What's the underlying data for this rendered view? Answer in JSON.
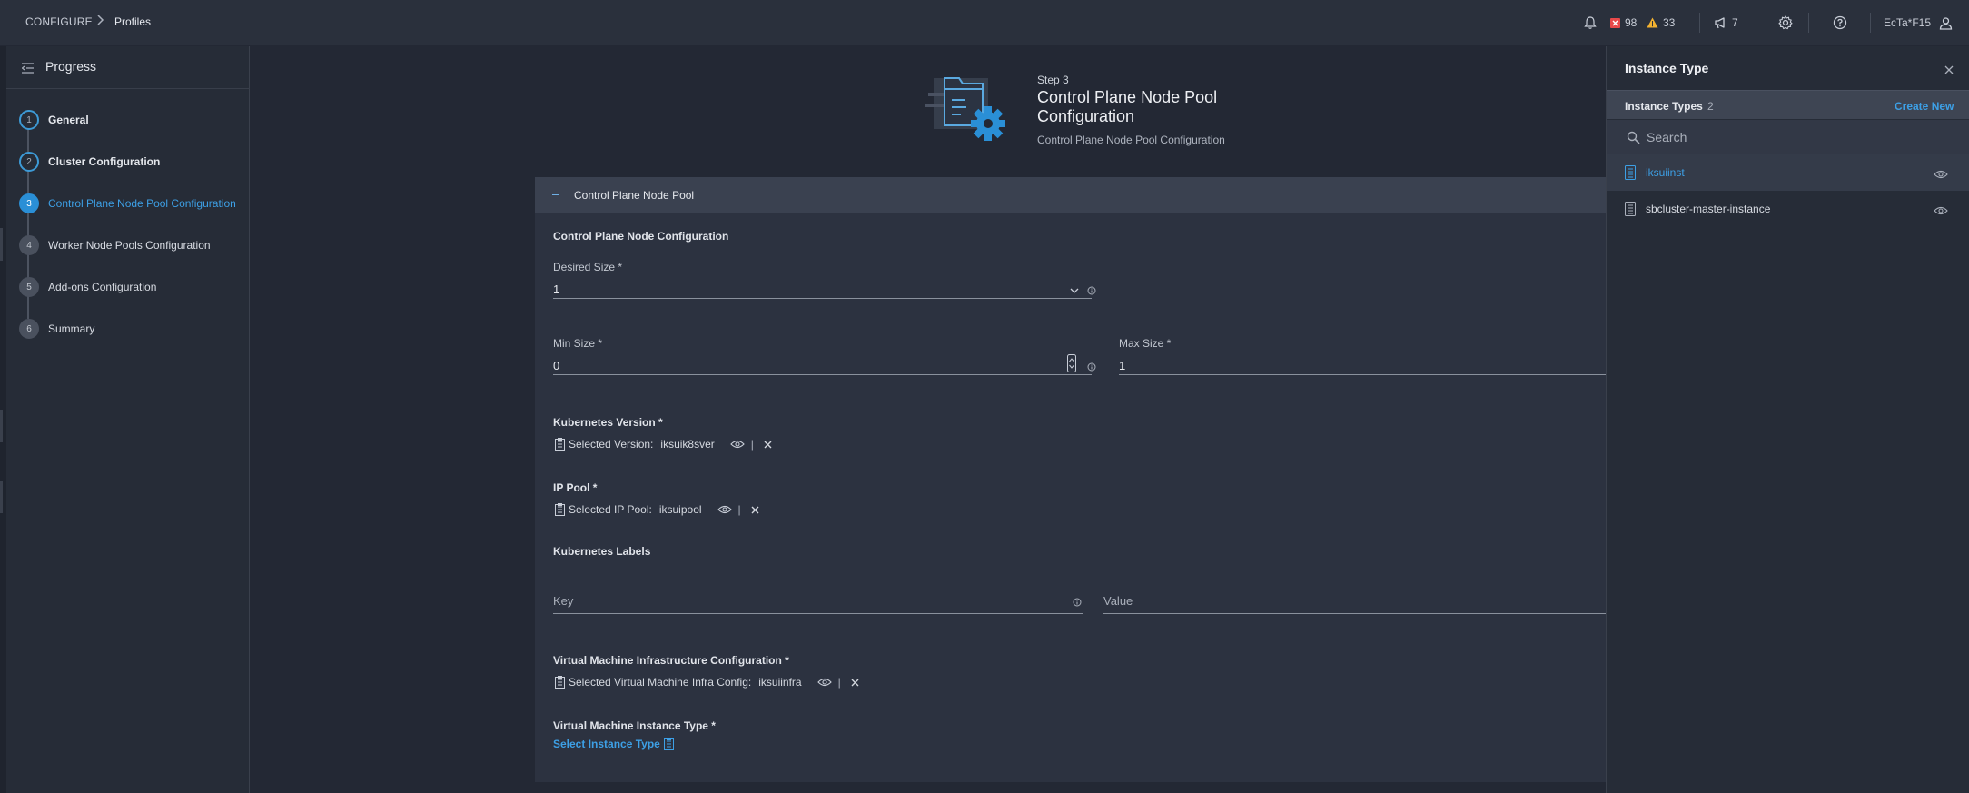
{
  "breadcrumb": {
    "root": "CONFIGURE",
    "current": "Profiles"
  },
  "topbar": {
    "critical_count": "98",
    "warning_count": "33",
    "announcement_count": "7",
    "user": "EcTa*F15"
  },
  "sidebar": {
    "title": "Progress",
    "steps": [
      {
        "num": "1",
        "label": "General",
        "state": "done"
      },
      {
        "num": "2",
        "label": "Cluster Configuration",
        "state": "done"
      },
      {
        "num": "3",
        "label": "Control Plane Node Pool Configuration",
        "state": "active"
      },
      {
        "num": "4",
        "label": "Worker Node Pools Configuration",
        "state": "todo"
      },
      {
        "num": "5",
        "label": "Add-ons Configuration",
        "state": "todo"
      },
      {
        "num": "6",
        "label": "Summary",
        "state": "todo"
      }
    ]
  },
  "header": {
    "step": "Step 3",
    "title": "Control Plane Node Pool Configuration",
    "subtitle": "Control Plane Node Pool Configuration"
  },
  "form": {
    "panel_title": "Control Plane Node Pool",
    "section_title": "Control Plane Node Configuration",
    "desired_size": {
      "label": "Desired Size *",
      "value": "1"
    },
    "min_size": {
      "label": "Min Size *",
      "value": "0"
    },
    "max_size": {
      "label": "Max Size *",
      "value": "1"
    },
    "k8s_version": {
      "label": "Kubernetes Version *",
      "prefix": "Selected Version:",
      "value": "iksuik8sver"
    },
    "ip_pool": {
      "label": "IP Pool *",
      "prefix": "Selected IP Pool:",
      "value": "iksuipool"
    },
    "k8s_labels": {
      "label": "Kubernetes Labels",
      "key_placeholder": "Key",
      "value_placeholder": "Value"
    },
    "vm_infra": {
      "label": "Virtual Machine Infrastructure Configuration *",
      "prefix": "Selected Virtual Machine Infra Config:",
      "value": "iksuiinfra"
    },
    "vm_instance": {
      "label": "Virtual Machine Instance Type *",
      "link": "Select Instance Type"
    }
  },
  "panel": {
    "title": "Instance Type",
    "list_title": "Instance Types",
    "count": "2",
    "create_new": "Create New",
    "search_placeholder": "Search",
    "items": [
      "iksuiinst",
      "sbcluster-master-instance"
    ]
  },
  "colors": {
    "accent": "#3da0e6",
    "critical": "#e8494a",
    "warning": "#f2b130"
  }
}
